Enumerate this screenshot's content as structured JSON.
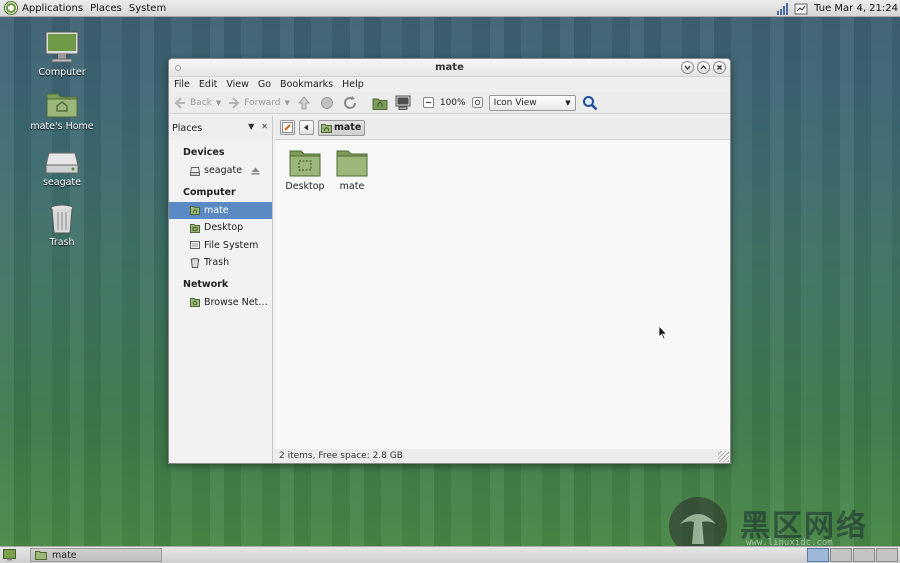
{
  "top_panel": {
    "menus": [
      "Applications",
      "Places",
      "System"
    ],
    "clock": "Tue Mar  4, 21:24"
  },
  "desktop": {
    "icons": [
      {
        "label": "Computer",
        "icon": "computer-icon"
      },
      {
        "label": "mate's Home",
        "icon": "home-folder-icon"
      },
      {
        "label": "seagate",
        "icon": "drive-icon"
      },
      {
        "label": "Trash",
        "icon": "trash-icon"
      }
    ]
  },
  "window": {
    "title": "mate",
    "menu": [
      "File",
      "Edit",
      "View",
      "Go",
      "Bookmarks",
      "Help"
    ],
    "toolbar": {
      "back_label": "Back",
      "forward_label": "Forward",
      "zoom": "100%",
      "view_mode": "Icon View"
    },
    "sidebar": {
      "header": "Places",
      "groups": [
        {
          "title": "Devices",
          "items": [
            {
              "label": "seagate",
              "icon": "drive-icon",
              "ejectable": true
            }
          ]
        },
        {
          "title": "Computer",
          "items": [
            {
              "label": "mate",
              "icon": "home-folder-icon",
              "selected": true
            },
            {
              "label": "Desktop",
              "icon": "desktop-folder-icon"
            },
            {
              "label": "File System",
              "icon": "filesystem-icon"
            },
            {
              "label": "Trash",
              "icon": "trash-icon"
            }
          ]
        },
        {
          "title": "Network",
          "items": [
            {
              "label": "Browse Net…",
              "icon": "network-icon"
            }
          ]
        }
      ]
    },
    "location": {
      "crumb": "mate"
    },
    "files": [
      {
        "label": "Desktop",
        "icon": "desktop-folder-icon"
      },
      {
        "label": "mate",
        "icon": "folder-icon"
      }
    ],
    "status": "2 items, Free space: 2.8 GB"
  },
  "bottom_panel": {
    "task": "mate"
  },
  "watermark": {
    "text": "黑区网络",
    "url": "www.linuxidc.com"
  },
  "colors": {
    "selection": "#5b89c4",
    "folder": "#8aa868",
    "accent_green": "#5b8a2f"
  }
}
